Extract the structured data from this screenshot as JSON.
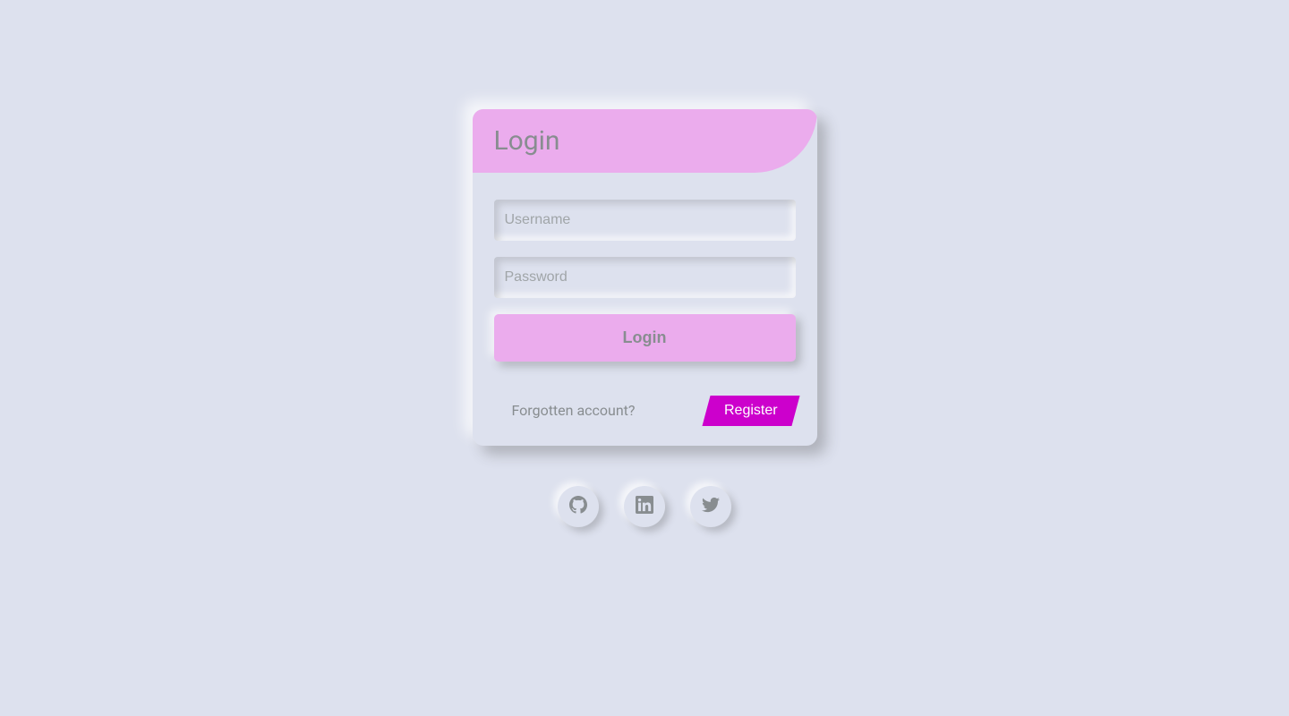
{
  "form": {
    "title": "Login",
    "username_placeholder": "Username",
    "password_placeholder": "Password",
    "login_button_label": "Login",
    "forgotten_label": "Forgotten account?",
    "register_label": "Register"
  },
  "socials": {
    "github": "github-icon",
    "linkedin": "linkedin-icon",
    "twitter": "twitter-icon"
  },
  "colors": {
    "background": "#dde1ee",
    "accent_light": "#ebaced",
    "accent_strong": "#cc00cc",
    "text_muted": "#888d90"
  }
}
